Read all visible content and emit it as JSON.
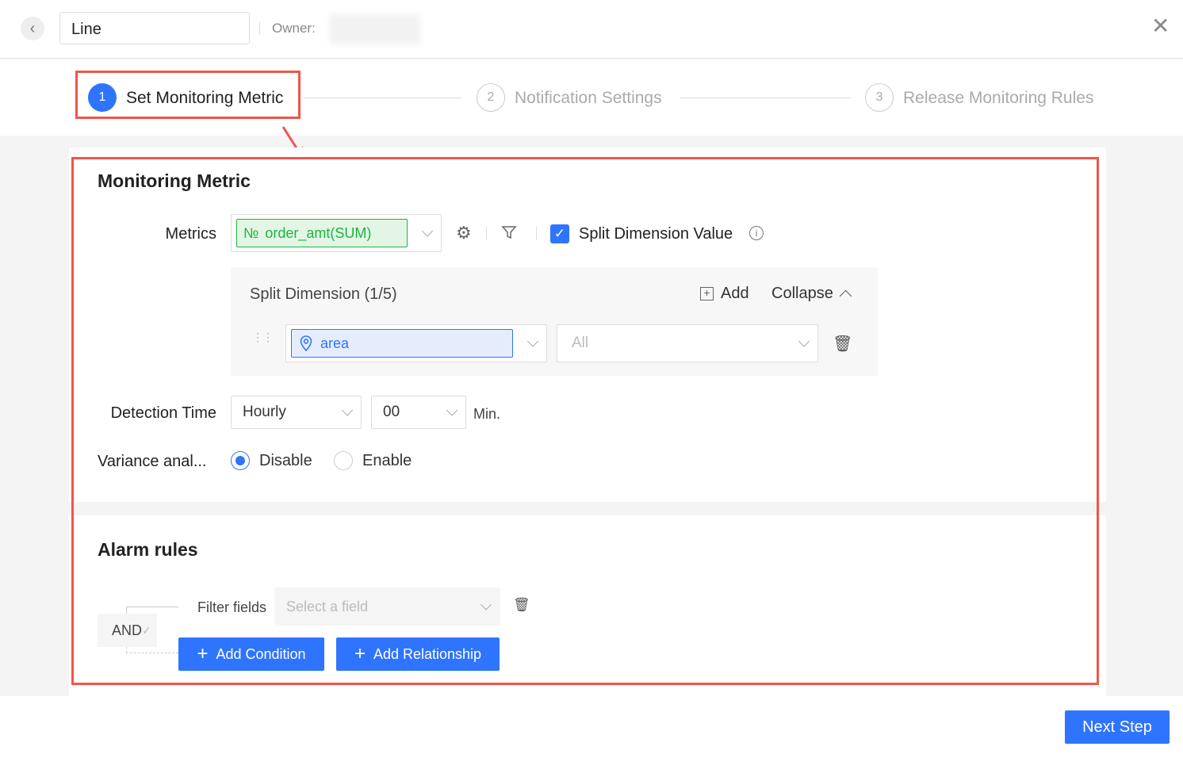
{
  "header": {
    "title_value": "Line",
    "owner_label": "Owner:"
  },
  "steps": [
    {
      "num": "1",
      "label": "Set Monitoring Metric"
    },
    {
      "num": "2",
      "label": "Notification Settings"
    },
    {
      "num": "3",
      "label": "Release Monitoring Rules"
    }
  ],
  "metric": {
    "section_title": "Monitoring Metric",
    "metrics_label": "Metrics",
    "metric_tag": "order_amt(SUM)",
    "metric_tag_icon": "№",
    "split_checkbox_label": "Split Dimension Value",
    "split_checked": true,
    "split_title": "Split Dimension (1/5)",
    "add_label": "Add",
    "collapse_label": "Collapse",
    "dimension_value": "area",
    "dimension_filter_placeholder": "All",
    "detection_label": "Detection Time",
    "detection_freq": "Hourly",
    "detection_minute": "00",
    "min_unit": "Min.",
    "variance_label": "Variance anal...",
    "radio_disable": "Disable",
    "radio_enable": "Enable",
    "variance_selected": "Disable"
  },
  "alarm": {
    "section_title": "Alarm rules",
    "logic": "AND",
    "filter_label": "Filter fields",
    "filter_placeholder": "Select a field",
    "add_condition": "Add Condition",
    "add_relationship": "Add Relationship"
  },
  "footer": {
    "next_label": "Next Step"
  },
  "colors": {
    "primary": "#2f74ff",
    "annotation": "#f2544a",
    "metric_tag_green": "#1db53b"
  }
}
